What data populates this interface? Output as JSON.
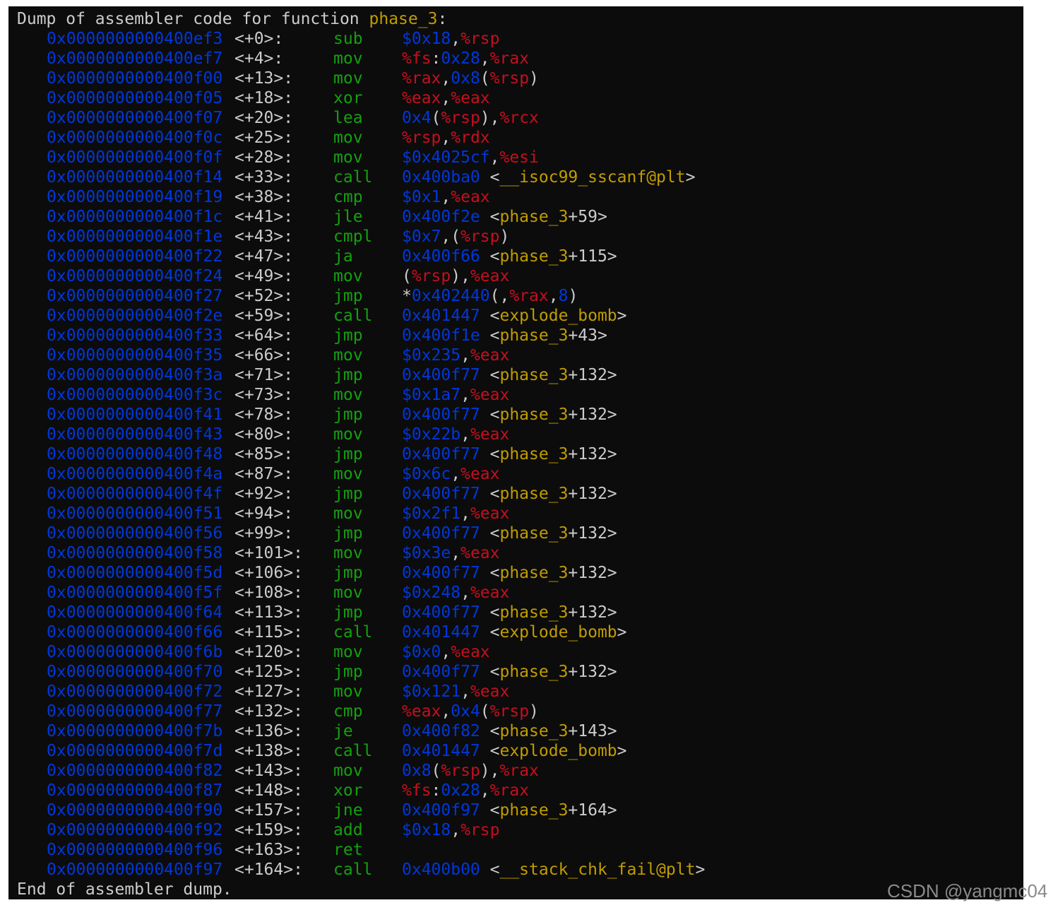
{
  "terminal": {
    "background": "#0c0c0c",
    "colors": {
      "address": "#0037da",
      "mnemonic": "#13a10e",
      "register": "#c50f1f",
      "number": "#0037da",
      "symbol": "#c19c00",
      "text": "#cccccc"
    },
    "header": {
      "prefix": "Dump of assembler code for function ",
      "function": "phase_3",
      "suffix": ":"
    },
    "footer": "End of assembler dump.",
    "instructions": [
      {
        "address": "0x0000000000400ef3",
        "offset": "<+0>:",
        "mnemonic": "sub",
        "operands": [
          [
            "n",
            "$0x18"
          ],
          [
            "p",
            ","
          ],
          [
            "r",
            "%rsp"
          ]
        ]
      },
      {
        "address": "0x0000000000400ef7",
        "offset": "<+4>:",
        "mnemonic": "mov",
        "operands": [
          [
            "r",
            "%fs"
          ],
          [
            "p",
            ":"
          ],
          [
            "n",
            "0x28"
          ],
          [
            "p",
            ","
          ],
          [
            "r",
            "%rax"
          ]
        ]
      },
      {
        "address": "0x0000000000400f00",
        "offset": "<+13>:",
        "mnemonic": "mov",
        "operands": [
          [
            "r",
            "%rax"
          ],
          [
            "p",
            ","
          ],
          [
            "n",
            "0x8"
          ],
          [
            "p",
            "("
          ],
          [
            "r",
            "%rsp"
          ],
          [
            "p",
            ")"
          ]
        ]
      },
      {
        "address": "0x0000000000400f05",
        "offset": "<+18>:",
        "mnemonic": "xor",
        "operands": [
          [
            "r",
            "%eax"
          ],
          [
            "p",
            ","
          ],
          [
            "r",
            "%eax"
          ]
        ]
      },
      {
        "address": "0x0000000000400f07",
        "offset": "<+20>:",
        "mnemonic": "lea",
        "operands": [
          [
            "n",
            "0x4"
          ],
          [
            "p",
            "("
          ],
          [
            "r",
            "%rsp"
          ],
          [
            "p",
            "),"
          ],
          [
            "r",
            "%rcx"
          ]
        ]
      },
      {
        "address": "0x0000000000400f0c",
        "offset": "<+25>:",
        "mnemonic": "mov",
        "operands": [
          [
            "r",
            "%rsp"
          ],
          [
            "p",
            ","
          ],
          [
            "r",
            "%rdx"
          ]
        ]
      },
      {
        "address": "0x0000000000400f0f",
        "offset": "<+28>:",
        "mnemonic": "mov",
        "operands": [
          [
            "n",
            "$0x4025cf"
          ],
          [
            "p",
            ","
          ],
          [
            "r",
            "%esi"
          ]
        ]
      },
      {
        "address": "0x0000000000400f14",
        "offset": "<+33>:",
        "mnemonic": "call",
        "operands": [
          [
            "n",
            "0x400ba0"
          ],
          [
            "p",
            " <"
          ],
          [
            "s",
            "__isoc99_sscanf@plt"
          ],
          [
            "p",
            ">"
          ]
        ]
      },
      {
        "address": "0x0000000000400f19",
        "offset": "<+38>:",
        "mnemonic": "cmp",
        "operands": [
          [
            "n",
            "$0x1"
          ],
          [
            "p",
            ","
          ],
          [
            "r",
            "%eax"
          ]
        ]
      },
      {
        "address": "0x0000000000400f1c",
        "offset": "<+41>:",
        "mnemonic": "jle",
        "operands": [
          [
            "n",
            "0x400f2e"
          ],
          [
            "p",
            " <"
          ],
          [
            "s",
            "phase_3"
          ],
          [
            "p",
            "+59>"
          ]
        ]
      },
      {
        "address": "0x0000000000400f1e",
        "offset": "<+43>:",
        "mnemonic": "cmpl",
        "operands": [
          [
            "n",
            "$0x7"
          ],
          [
            "p",
            ",("
          ],
          [
            "r",
            "%rsp"
          ],
          [
            "p",
            ")"
          ]
        ]
      },
      {
        "address": "0x0000000000400f22",
        "offset": "<+47>:",
        "mnemonic": "ja",
        "operands": [
          [
            "n",
            "0x400f66"
          ],
          [
            "p",
            " <"
          ],
          [
            "s",
            "phase_3"
          ],
          [
            "p",
            "+115>"
          ]
        ]
      },
      {
        "address": "0x0000000000400f24",
        "offset": "<+49>:",
        "mnemonic": "mov",
        "operands": [
          [
            "p",
            "("
          ],
          [
            "r",
            "%rsp"
          ],
          [
            "p",
            "),"
          ],
          [
            "r",
            "%eax"
          ]
        ]
      },
      {
        "address": "0x0000000000400f27",
        "offset": "<+52>:",
        "mnemonic": "jmp",
        "operands": [
          [
            "p",
            "*"
          ],
          [
            "n",
            "0x402440"
          ],
          [
            "p",
            "(,"
          ],
          [
            "r",
            "%rax"
          ],
          [
            "p",
            ","
          ],
          [
            "n",
            "8"
          ],
          [
            "p",
            ")"
          ]
        ]
      },
      {
        "address": "0x0000000000400f2e",
        "offset": "<+59>:",
        "mnemonic": "call",
        "operands": [
          [
            "n",
            "0x401447"
          ],
          [
            "p",
            " <"
          ],
          [
            "s",
            "explode_bomb"
          ],
          [
            "p",
            ">"
          ]
        ]
      },
      {
        "address": "0x0000000000400f33",
        "offset": "<+64>:",
        "mnemonic": "jmp",
        "operands": [
          [
            "n",
            "0x400f1e"
          ],
          [
            "p",
            " <"
          ],
          [
            "s",
            "phase_3"
          ],
          [
            "p",
            "+43>"
          ]
        ]
      },
      {
        "address": "0x0000000000400f35",
        "offset": "<+66>:",
        "mnemonic": "mov",
        "operands": [
          [
            "n",
            "$0x235"
          ],
          [
            "p",
            ","
          ],
          [
            "r",
            "%eax"
          ]
        ]
      },
      {
        "address": "0x0000000000400f3a",
        "offset": "<+71>:",
        "mnemonic": "jmp",
        "operands": [
          [
            "n",
            "0x400f77"
          ],
          [
            "p",
            " <"
          ],
          [
            "s",
            "phase_3"
          ],
          [
            "p",
            "+132>"
          ]
        ]
      },
      {
        "address": "0x0000000000400f3c",
        "offset": "<+73>:",
        "mnemonic": "mov",
        "operands": [
          [
            "n",
            "$0x1a7"
          ],
          [
            "p",
            ","
          ],
          [
            "r",
            "%eax"
          ]
        ]
      },
      {
        "address": "0x0000000000400f41",
        "offset": "<+78>:",
        "mnemonic": "jmp",
        "operands": [
          [
            "n",
            "0x400f77"
          ],
          [
            "p",
            " <"
          ],
          [
            "s",
            "phase_3"
          ],
          [
            "p",
            "+132>"
          ]
        ]
      },
      {
        "address": "0x0000000000400f43",
        "offset": "<+80>:",
        "mnemonic": "mov",
        "operands": [
          [
            "n",
            "$0x22b"
          ],
          [
            "p",
            ","
          ],
          [
            "r",
            "%eax"
          ]
        ]
      },
      {
        "address": "0x0000000000400f48",
        "offset": "<+85>:",
        "mnemonic": "jmp",
        "operands": [
          [
            "n",
            "0x400f77"
          ],
          [
            "p",
            " <"
          ],
          [
            "s",
            "phase_3"
          ],
          [
            "p",
            "+132>"
          ]
        ]
      },
      {
        "address": "0x0000000000400f4a",
        "offset": "<+87>:",
        "mnemonic": "mov",
        "operands": [
          [
            "n",
            "$0x6c"
          ],
          [
            "p",
            ","
          ],
          [
            "r",
            "%eax"
          ]
        ]
      },
      {
        "address": "0x0000000000400f4f",
        "offset": "<+92>:",
        "mnemonic": "jmp",
        "operands": [
          [
            "n",
            "0x400f77"
          ],
          [
            "p",
            " <"
          ],
          [
            "s",
            "phase_3"
          ],
          [
            "p",
            "+132>"
          ]
        ]
      },
      {
        "address": "0x0000000000400f51",
        "offset": "<+94>:",
        "mnemonic": "mov",
        "operands": [
          [
            "n",
            "$0x2f1"
          ],
          [
            "p",
            ","
          ],
          [
            "r",
            "%eax"
          ]
        ]
      },
      {
        "address": "0x0000000000400f56",
        "offset": "<+99>:",
        "mnemonic": "jmp",
        "operands": [
          [
            "n",
            "0x400f77"
          ],
          [
            "p",
            " <"
          ],
          [
            "s",
            "phase_3"
          ],
          [
            "p",
            "+132>"
          ]
        ]
      },
      {
        "address": "0x0000000000400f58",
        "offset": "<+101>:",
        "mnemonic": "mov",
        "operands": [
          [
            "n",
            "$0x3e"
          ],
          [
            "p",
            ","
          ],
          [
            "r",
            "%eax"
          ]
        ]
      },
      {
        "address": "0x0000000000400f5d",
        "offset": "<+106>:",
        "mnemonic": "jmp",
        "operands": [
          [
            "n",
            "0x400f77"
          ],
          [
            "p",
            " <"
          ],
          [
            "s",
            "phase_3"
          ],
          [
            "p",
            "+132>"
          ]
        ]
      },
      {
        "address": "0x0000000000400f5f",
        "offset": "<+108>:",
        "mnemonic": "mov",
        "operands": [
          [
            "n",
            "$0x248"
          ],
          [
            "p",
            ","
          ],
          [
            "r",
            "%eax"
          ]
        ]
      },
      {
        "address": "0x0000000000400f64",
        "offset": "<+113>:",
        "mnemonic": "jmp",
        "operands": [
          [
            "n",
            "0x400f77"
          ],
          [
            "p",
            " <"
          ],
          [
            "s",
            "phase_3"
          ],
          [
            "p",
            "+132>"
          ]
        ]
      },
      {
        "address": "0x0000000000400f66",
        "offset": "<+115>:",
        "mnemonic": "call",
        "operands": [
          [
            "n",
            "0x401447"
          ],
          [
            "p",
            " <"
          ],
          [
            "s",
            "explode_bomb"
          ],
          [
            "p",
            ">"
          ]
        ]
      },
      {
        "address": "0x0000000000400f6b",
        "offset": "<+120>:",
        "mnemonic": "mov",
        "operands": [
          [
            "n",
            "$0x0"
          ],
          [
            "p",
            ","
          ],
          [
            "r",
            "%eax"
          ]
        ]
      },
      {
        "address": "0x0000000000400f70",
        "offset": "<+125>:",
        "mnemonic": "jmp",
        "operands": [
          [
            "n",
            "0x400f77"
          ],
          [
            "p",
            " <"
          ],
          [
            "s",
            "phase_3"
          ],
          [
            "p",
            "+132>"
          ]
        ]
      },
      {
        "address": "0x0000000000400f72",
        "offset": "<+127>:",
        "mnemonic": "mov",
        "operands": [
          [
            "n",
            "$0x121"
          ],
          [
            "p",
            ","
          ],
          [
            "r",
            "%eax"
          ]
        ]
      },
      {
        "address": "0x0000000000400f77",
        "offset": "<+132>:",
        "mnemonic": "cmp",
        "operands": [
          [
            "r",
            "%eax"
          ],
          [
            "p",
            ","
          ],
          [
            "n",
            "0x4"
          ],
          [
            "p",
            "("
          ],
          [
            "r",
            "%rsp"
          ],
          [
            "p",
            ")"
          ]
        ]
      },
      {
        "address": "0x0000000000400f7b",
        "offset": "<+136>:",
        "mnemonic": "je",
        "operands": [
          [
            "n",
            "0x400f82"
          ],
          [
            "p",
            " <"
          ],
          [
            "s",
            "phase_3"
          ],
          [
            "p",
            "+143>"
          ]
        ]
      },
      {
        "address": "0x0000000000400f7d",
        "offset": "<+138>:",
        "mnemonic": "call",
        "operands": [
          [
            "n",
            "0x401447"
          ],
          [
            "p",
            " <"
          ],
          [
            "s",
            "explode_bomb"
          ],
          [
            "p",
            ">"
          ]
        ]
      },
      {
        "address": "0x0000000000400f82",
        "offset": "<+143>:",
        "mnemonic": "mov",
        "operands": [
          [
            "n",
            "0x8"
          ],
          [
            "p",
            "("
          ],
          [
            "r",
            "%rsp"
          ],
          [
            "p",
            "),"
          ],
          [
            "r",
            "%rax"
          ]
        ]
      },
      {
        "address": "0x0000000000400f87",
        "offset": "<+148>:",
        "mnemonic": "xor",
        "operands": [
          [
            "r",
            "%fs"
          ],
          [
            "p",
            ":"
          ],
          [
            "n",
            "0x28"
          ],
          [
            "p",
            ","
          ],
          [
            "r",
            "%rax"
          ]
        ]
      },
      {
        "address": "0x0000000000400f90",
        "offset": "<+157>:",
        "mnemonic": "jne",
        "operands": [
          [
            "n",
            "0x400f97"
          ],
          [
            "p",
            " <"
          ],
          [
            "s",
            "phase_3"
          ],
          [
            "p",
            "+164>"
          ]
        ]
      },
      {
        "address": "0x0000000000400f92",
        "offset": "<+159>:",
        "mnemonic": "add",
        "operands": [
          [
            "n",
            "$0x18"
          ],
          [
            "p",
            ","
          ],
          [
            "r",
            "%rsp"
          ]
        ]
      },
      {
        "address": "0x0000000000400f96",
        "offset": "<+163>:",
        "mnemonic": "ret",
        "operands": []
      },
      {
        "address": "0x0000000000400f97",
        "offset": "<+164>:",
        "mnemonic": "call",
        "operands": [
          [
            "n",
            "0x400b00"
          ],
          [
            "p",
            " <"
          ],
          [
            "s",
            "__stack_chk_fail@plt"
          ],
          [
            "p",
            ">"
          ]
        ]
      }
    ]
  },
  "watermark": "CSDN @yangmc04"
}
